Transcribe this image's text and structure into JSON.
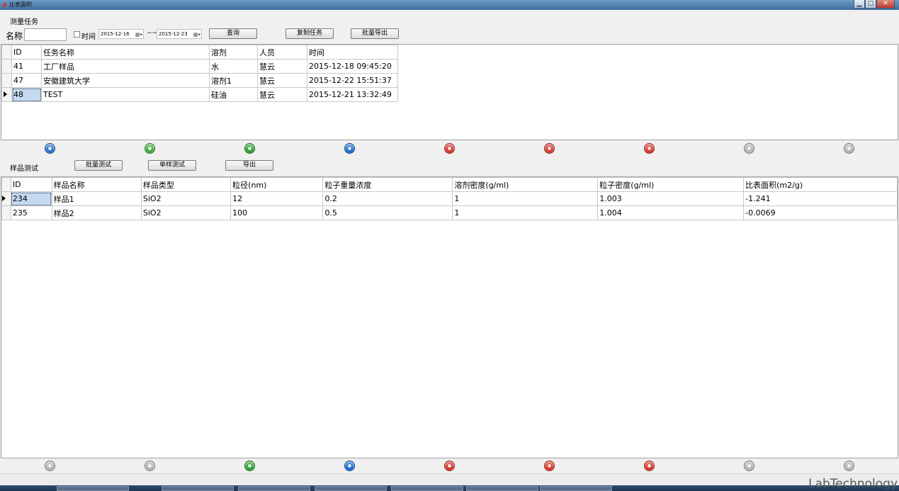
{
  "window": {
    "title": "比表面积"
  },
  "task_section": {
    "title": "测量任务",
    "name_label": "名称",
    "name_value": "",
    "time_label": "时间",
    "date_from": "2015-12-16",
    "date_sep": "~~",
    "date_to": "2015-12-23",
    "query_button": "查询",
    "copy_button": "复制任务",
    "export_button": "批量导出",
    "columns": [
      "ID",
      "任务名称",
      "溶剂",
      "人员",
      "时间"
    ],
    "rows": [
      [
        "41",
        "工厂样品",
        "水",
        "慧云",
        "2015-12-18 09:45:20"
      ],
      [
        "47",
        "安徽建筑大学",
        "溶剂1",
        "慧云",
        "2015-12-22 15:51:37"
      ],
      [
        "48",
        "TEST",
        "硅油",
        "慧云",
        "2015-12-21 13:32:49"
      ]
    ]
  },
  "sample_section": {
    "title": "样品测试",
    "batch_test_button": "批量测试",
    "single_test_button": "单样测试",
    "export_button": "导出",
    "columns": [
      "ID",
      "样品名称",
      "样品类型",
      "粒径(nm)",
      "粒子重量浓度",
      "溶剂密度(g/ml)",
      "粒子密度(g/ml)",
      "比表面积(m2/g)"
    ],
    "rows": [
      [
        "234",
        "样品1",
        "SiO2",
        "12",
        "0.2",
        "1",
        "1.003",
        "-1.241"
      ],
      [
        "235",
        "样品2",
        "SiO2",
        "100",
        "0.5",
        "1",
        "1.004",
        "-0.0069"
      ]
    ]
  },
  "nav_top": [
    {
      "icon": "first-icon",
      "color": "#2f74c9"
    },
    {
      "icon": "prev-icon",
      "color": "#3fae3a"
    },
    {
      "icon": "next-icon",
      "color": "#2fa32f"
    },
    {
      "icon": "last-icon",
      "color": "#1d6fd1"
    },
    {
      "icon": "add-icon",
      "color": "#d8382c"
    },
    {
      "icon": "delete-icon",
      "color": "#d8382c"
    },
    {
      "icon": "edit-icon",
      "color": "#d8382c"
    },
    {
      "icon": "save-icon",
      "color": "#b5b5b5"
    },
    {
      "icon": "cancel-icon",
      "color": "#b5b5b5"
    }
  ],
  "nav_bottom": [
    {
      "icon": "first-icon",
      "color": "#b5b5b5"
    },
    {
      "icon": "prev-icon",
      "color": "#b5b5b5"
    },
    {
      "icon": "next-icon",
      "color": "#2fa32f"
    },
    {
      "icon": "last-icon",
      "color": "#1d6fd1"
    },
    {
      "icon": "add-icon",
      "color": "#d8382c"
    },
    {
      "icon": "delete-icon",
      "color": "#d8382c"
    },
    {
      "icon": "edit-icon",
      "color": "#d8382c"
    },
    {
      "icon": "save-icon",
      "color": "#b5b5b5"
    },
    {
      "icon": "cancel-icon",
      "color": "#b5b5b5"
    }
  ],
  "watermark": "LabTechnology"
}
